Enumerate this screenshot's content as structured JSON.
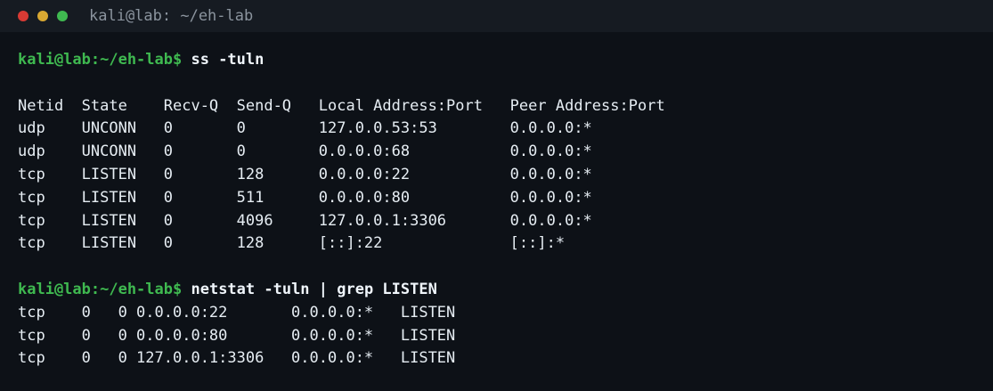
{
  "window": {
    "title": "kali@lab: ~/eh-lab"
  },
  "terminal": {
    "prompt": "kali@lab:~/eh-lab$",
    "lines": [
      {
        "type": "command",
        "text": "ss -tuln"
      },
      {
        "type": "blank",
        "text": ""
      },
      {
        "type": "output",
        "text": "Netid  State    Recv-Q  Send-Q   Local Address:Port   Peer Address:Port"
      },
      {
        "type": "output",
        "text": "udp    UNCONN   0       0        127.0.0.53:53        0.0.0.0:*"
      },
      {
        "type": "output",
        "text": "udp    UNCONN   0       0        0.0.0.0:68           0.0.0.0:*"
      },
      {
        "type": "output",
        "text": "tcp    LISTEN   0       128      0.0.0.0:22           0.0.0.0:*"
      },
      {
        "type": "output",
        "text": "tcp    LISTEN   0       511      0.0.0.0:80           0.0.0.0:*"
      },
      {
        "type": "output",
        "text": "tcp    LISTEN   0       4096     127.0.0.1:3306       0.0.0.0:*"
      },
      {
        "type": "output",
        "text": "tcp    LISTEN   0       128      [::]:22              [::]:*"
      },
      {
        "type": "blank",
        "text": ""
      },
      {
        "type": "command",
        "text": "netstat -tuln | grep LISTEN"
      },
      {
        "type": "output",
        "text": "tcp    0   0 0.0.0.0:22       0.0.0.0:*   LISTEN"
      },
      {
        "type": "output",
        "text": "tcp    0   0 0.0.0.0:80       0.0.0.0:*   LISTEN"
      },
      {
        "type": "output",
        "text": "tcp    0   0 127.0.0.1:3306   0.0.0.0:*   LISTEN"
      }
    ]
  },
  "colors": {
    "background": "#0d1117",
    "titlebar": "#161b22",
    "prompt": "#3fb950",
    "text": "#e6edf3",
    "close": "#d83a34",
    "minimize": "#d9a832",
    "maximize": "#3fb950"
  }
}
